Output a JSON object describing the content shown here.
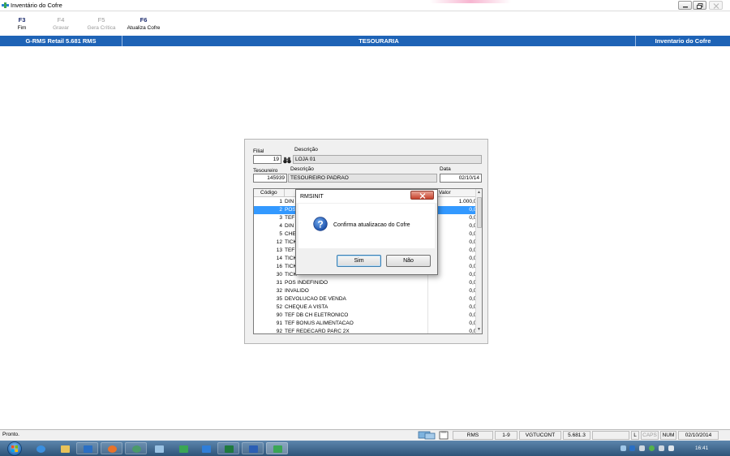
{
  "window": {
    "title": "Inventário do Cofre"
  },
  "toolbar": {
    "items": [
      {
        "key": "F3",
        "label": "Fim",
        "enabled": true
      },
      {
        "key": "F4",
        "label": "Gravar",
        "enabled": false
      },
      {
        "key": "F5",
        "label": "Gera Crítica",
        "enabled": false
      },
      {
        "key": "F6",
        "label": "Atualiza Cofre",
        "enabled": true
      }
    ]
  },
  "header": {
    "left": "G-RMS Retail 5.681 RMS",
    "center": "TESOURARIA",
    "right": "Inventario do Cofre"
  },
  "form": {
    "filial_label": "Filial",
    "filial_value": "19",
    "descricao_label": "Descrição",
    "filial_desc": "LOJA 01",
    "tesoureiro_label": "Tesoureiro",
    "tesoureiro_value": "145939",
    "tesoureiro_desc_label": "Descrição",
    "tesoureiro_desc": "TESOUREIRO PADRAO",
    "data_label": "Data",
    "data_value": "02/10/14"
  },
  "grid": {
    "col_code": "Código",
    "col_value": "Valor",
    "rows": [
      {
        "code": "1",
        "desc": "DIN",
        "value": "1.000,00",
        "selected": false
      },
      {
        "code": "2",
        "desc": "POS",
        "value": "0,00",
        "selected": true
      },
      {
        "code": "3",
        "desc": "TEF",
        "value": "0,00",
        "selected": false
      },
      {
        "code": "4",
        "desc": "DIN",
        "value": "0,00",
        "selected": false
      },
      {
        "code": "5",
        "desc": "CHE",
        "value": "0,00",
        "selected": false
      },
      {
        "code": "12",
        "desc": "TICK",
        "value": "0,00",
        "selected": false
      },
      {
        "code": "13",
        "desc": "TEF",
        "value": "0,00",
        "selected": false
      },
      {
        "code": "14",
        "desc": "TICK",
        "value": "0,00",
        "selected": false
      },
      {
        "code": "16",
        "desc": "TICK",
        "value": "0,00",
        "selected": false
      },
      {
        "code": "30",
        "desc": "TICK",
        "value": "0,00",
        "selected": false
      },
      {
        "code": "31",
        "desc": "POS INDEFINIDO",
        "value": "0,00",
        "selected": false
      },
      {
        "code": "32",
        "desc": "INVALIDO",
        "value": "0,00",
        "selected": false
      },
      {
        "code": "35",
        "desc": "DEVOLUCAO DE VENDA",
        "value": "0,00",
        "selected": false
      },
      {
        "code": "52",
        "desc": "CHEQUE A VISTA",
        "value": "0,00",
        "selected": false
      },
      {
        "code": "90",
        "desc": "TEF DB CH ELETRONICO",
        "value": "0,00",
        "selected": false
      },
      {
        "code": "91",
        "desc": "TEF BONUS ALIMENTACAO",
        "value": "0,00",
        "selected": false
      },
      {
        "code": "92",
        "desc": "TEF REDECARD PARC 2X",
        "value": "0,00",
        "selected": false
      }
    ]
  },
  "dialog": {
    "title": "RMSINIT",
    "message": "Confirma atualizacao do Cofre",
    "yes_label": "Sim",
    "no_label": "Não",
    "icon": "question-icon"
  },
  "statusbar": {
    "status": "Pronto.",
    "panels": [
      "RMS",
      "1-9",
      "VGTUCONT",
      "5.681.3",
      "L",
      "CAPS",
      "NUM",
      "02/10/2014"
    ]
  },
  "taskbar": {
    "clock": "16:41"
  },
  "colors": {
    "header_blue": "#1e63b6",
    "selection_blue": "#3399ff",
    "toolbar_key": "#1b2a6d"
  }
}
